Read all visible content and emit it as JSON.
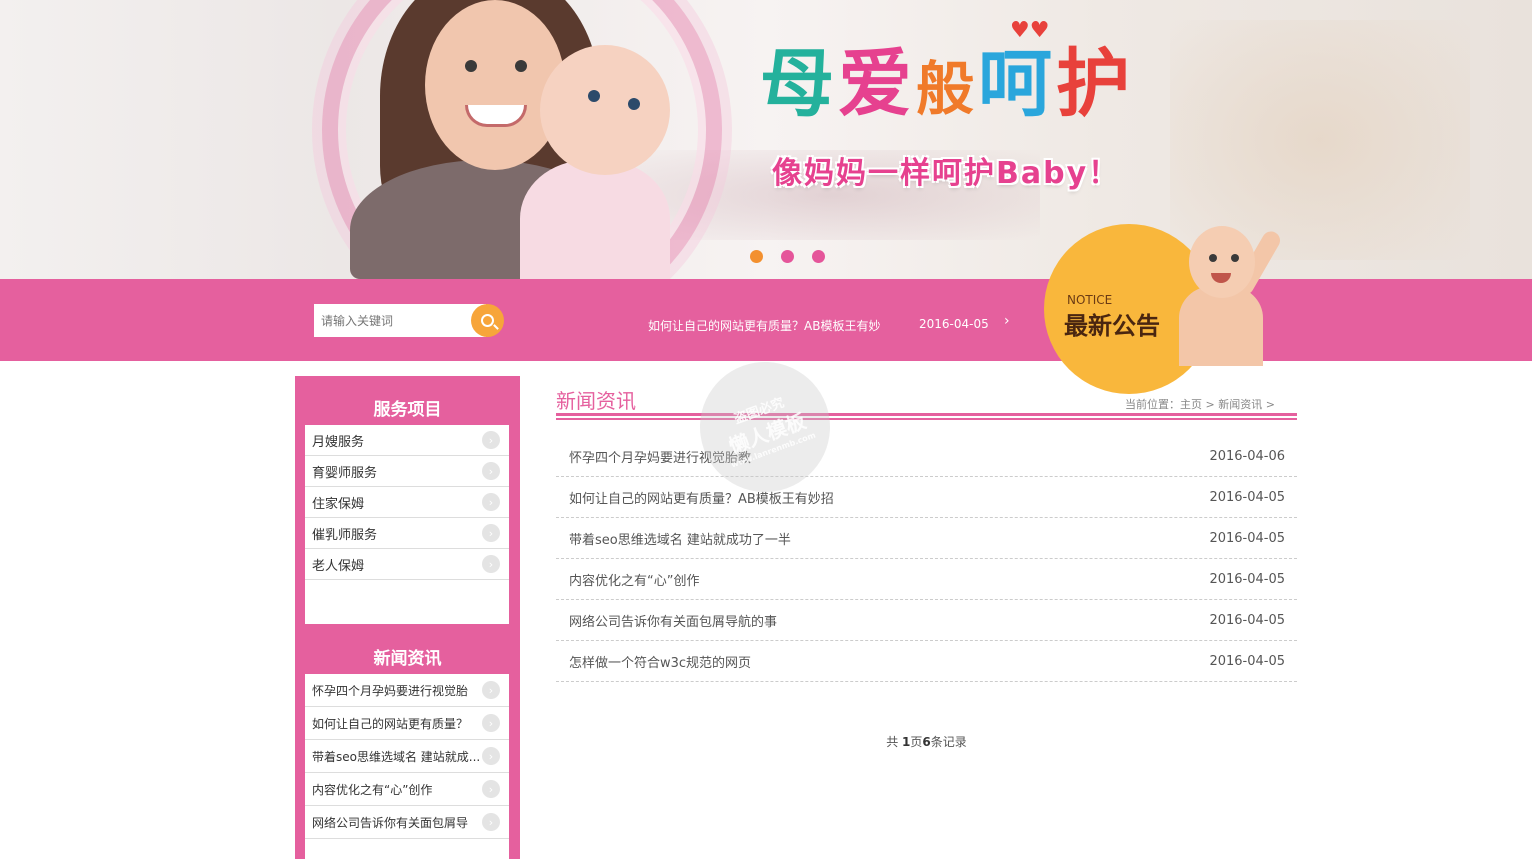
{
  "banner": {
    "logo_title_parts": [
      "母",
      "爱",
      "般",
      "呵",
      "护"
    ],
    "logo_subtitle": "像妈妈一样呵护Baby！",
    "slides": 3,
    "active_slide": 1
  },
  "search": {
    "placeholder": "请输入关键词",
    "icon": "search-icon"
  },
  "ticker": {
    "title": "如何让自己的网站更有质量？AB模板王有妙",
    "date": "2016-04-05",
    "arrow": "›"
  },
  "notice": {
    "label_en": "NOTICE",
    "label_cn": "最新公告"
  },
  "sidebar": {
    "services_title": "服务项目",
    "services": [
      {
        "label": "月嫂服务"
      },
      {
        "label": "育婴师服务"
      },
      {
        "label": "住家保姆"
      },
      {
        "label": "催乳师服务"
      },
      {
        "label": "老人保姆"
      }
    ],
    "news_title": "新闻资讯",
    "news": [
      {
        "label": "怀孕四个月孕妈要进行视觉胎"
      },
      {
        "label": "如何让自己的网站更有质量？"
      },
      {
        "label": "带着seo思维选域名 建站就成..."
      },
      {
        "label": "内容优化之有“心”创作"
      },
      {
        "label": "网络公司告诉你有关面包屑导"
      }
    ]
  },
  "main": {
    "title": "新闻资讯",
    "breadcrumb": "当前位置：主页 > 新闻资讯 >",
    "news": [
      {
        "title": "怀孕四个月孕妈要进行视觉胎教",
        "date": "2016-04-06"
      },
      {
        "title": "如何让自己的网站更有质量？AB模板王有妙招",
        "date": "2016-04-05"
      },
      {
        "title": "带着seo思维选域名 建站就成功了一半",
        "date": "2016-04-05"
      },
      {
        "title": "内容优化之有“心”创作",
        "date": "2016-04-05"
      },
      {
        "title": "网络公司告诉你有关面包屑导航的事",
        "date": "2016-04-05"
      },
      {
        "title": "怎样做一个符合w3c规范的网页",
        "date": "2016-04-05"
      }
    ],
    "pager": {
      "prefix": "共 ",
      "pages": "1",
      "mid": "页",
      "records": "6",
      "suffix": "条记录"
    }
  },
  "watermark": {
    "line1": "盗图必究",
    "line2": "懒人模板",
    "line3": "www.lanrenmb.com"
  },
  "colors": {
    "brand_pink": "#e5609e",
    "accent_orange": "#f7a53a",
    "notice_yellow": "#f9b73c"
  }
}
